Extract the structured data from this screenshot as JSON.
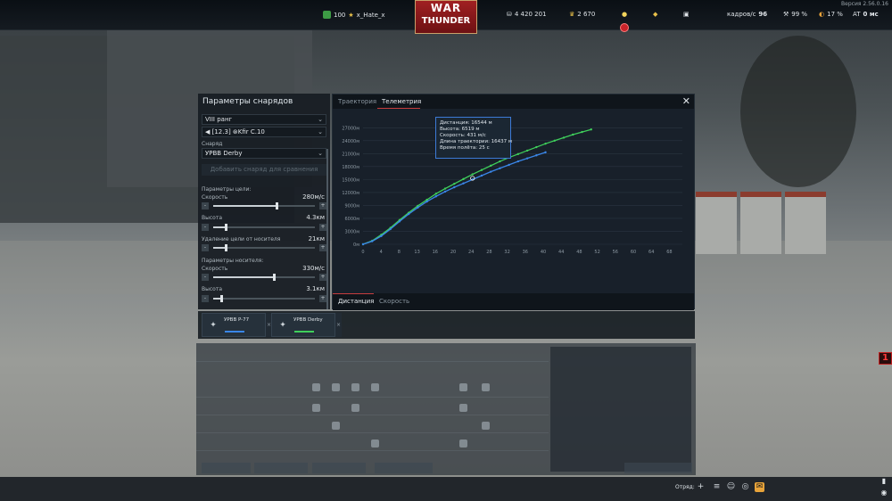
{
  "app": {
    "version": "Версия 2.56.0.16"
  },
  "topbar": {
    "rank_value": "100",
    "player_name": "x_Hate_x",
    "silver_lions": "4 420 201",
    "golden_eagles": "2 670",
    "fps_label": "кадров/с",
    "fps_value": "96",
    "cpu_load": "99 %",
    "gpu_load": "17 %",
    "ping_label": "AT",
    "ping_value": "0 мс"
  },
  "logo": {
    "line1": "WAR",
    "line2": "THUNDER"
  },
  "panel": {
    "title": "Параметры снарядов",
    "rank_select": "VIII ранг",
    "vehicle_select": "[12.3] ⊛Kfir C.10",
    "shell_label": "Снаряд",
    "shell_select": "УРВВ Derby",
    "add_button": "Добавить снаряд для сравнения",
    "target_params_label": "Параметры цели:",
    "target_speed_label": "Скорость",
    "target_speed_value": "280м/с",
    "target_alt_label": "Высота",
    "target_alt_value": "4.3км",
    "target_dist_label": "Удаление цели от носителя",
    "target_dist_value": "21км",
    "carrier_params_label": "Параметры носителя:",
    "carrier_speed_label": "Скорость",
    "carrier_speed_value": "330м/с",
    "carrier_alt_label": "Высота",
    "carrier_alt_value": "3.1км",
    "slider_minus": "-",
    "slider_plus": "+",
    "sliders": {
      "target_speed": 0.62,
      "target_alt": 0.12,
      "target_dist": 0.12,
      "carrier_speed": 0.6,
      "carrier_alt": 0.08
    }
  },
  "chart_window": {
    "tab_trajectory": "Траектория",
    "tab_telemetry": "Телеметрия",
    "close_glyph": "✕",
    "bottom_tab_distance": "Дистанция",
    "bottom_tab_speed": "Скорость",
    "tooltip": {
      "distance": "Дистанция: 16544 м",
      "altitude": "Высота: 6519 м",
      "speed": "Скорость: 431 м/с",
      "traj_length": "Длина траектории: 16437 м",
      "flight_time": "Время полёта: 25 с"
    }
  },
  "chart_data": {
    "type": "line",
    "x_ticks": [
      "0",
      "4",
      "8",
      "13",
      "16",
      "20",
      "24",
      "28",
      "32",
      "36",
      "40",
      "44",
      "48",
      "52",
      "56",
      "60",
      "64",
      "68"
    ],
    "y_ticks": [
      "0м",
      "3000м",
      "6000м",
      "9000м",
      "12000м",
      "15000м",
      "18000м",
      "21000м",
      "24000м",
      "27000м"
    ],
    "xlim": [
      0,
      70
    ],
    "ylim": [
      0,
      28500
    ],
    "grid": true,
    "series": [
      {
        "name": "УРВВ Derby",
        "color": "#3fcf5b",
        "x": [
          0,
          2,
          4,
          6,
          8,
          10,
          12,
          14,
          16,
          18,
          20,
          22,
          24,
          26,
          28,
          30,
          32,
          34,
          36,
          38,
          40,
          42,
          44,
          46,
          48,
          50
        ],
        "y": [
          0,
          800,
          2200,
          3800,
          5600,
          7300,
          8900,
          10300,
          11700,
          12900,
          14000,
          15100,
          16200,
          17200,
          18200,
          19200,
          20100,
          20900,
          21700,
          22500,
          23300,
          24000,
          24700,
          25400,
          26000,
          26600
        ]
      },
      {
        "name": "УРВВ P-77",
        "color": "#3a86e8",
        "x": [
          0,
          2,
          4,
          6,
          8,
          10,
          12,
          14,
          16,
          18,
          20,
          22,
          24,
          26,
          28,
          30,
          32,
          34,
          36,
          38,
          40
        ],
        "y": [
          0,
          700,
          1900,
          3500,
          5300,
          7000,
          8500,
          9900,
          11100,
          12200,
          13200,
          14100,
          15000,
          15900,
          16800,
          17600,
          18400,
          19200,
          19900,
          20600,
          21300
        ]
      }
    ]
  },
  "compare": {
    "cards": [
      {
        "name": "УРВВ P-77",
        "color": "#3a86e8"
      },
      {
        "name": "УРВВ Derby",
        "color": "#3fcf5b"
      }
    ],
    "close_glyph": "×"
  },
  "bottombar": {
    "squad_label": "Отряд:"
  },
  "side_flag": "1"
}
